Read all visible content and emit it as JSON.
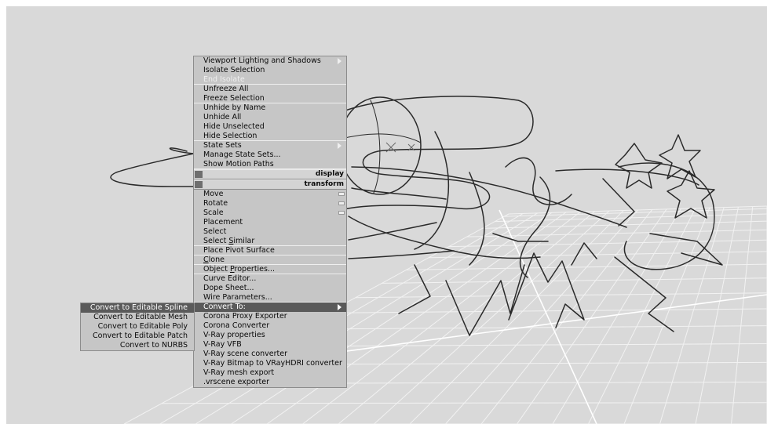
{
  "quad_menu": {
    "items_top": [
      {
        "label": "Viewport Lighting and Shadows",
        "submenu": true
      },
      {
        "label": "Isolate Selection"
      },
      {
        "label": "End Isolate",
        "disabled": true
      },
      {
        "label": "Unfreeze All"
      },
      {
        "label": "Freeze Selection"
      },
      {
        "label": "Unhide by Name"
      },
      {
        "label": "Unhide All"
      },
      {
        "label": "Hide Unselected"
      },
      {
        "label": "Hide Selection"
      },
      {
        "label": "State Sets",
        "submenu": true
      },
      {
        "label": "Manage State Sets..."
      },
      {
        "label": "Show Motion Paths"
      }
    ],
    "display_header": "display",
    "transform_header": "transform",
    "items_transform": [
      {
        "label_pre": "Move",
        "has_settings": true
      },
      {
        "label_pre": "Rotate",
        "has_settings": true
      },
      {
        "label_pre": "Scale",
        "has_settings": true
      },
      {
        "label_pre": "Placement"
      },
      {
        "label_pre": "Select"
      },
      {
        "label_pre": "Select ",
        "label_u": "S",
        "label_post": "imilar"
      },
      {
        "label_pre": "Place Pivot Surface"
      },
      {
        "label_pre": "",
        "label_u": "C",
        "label_post": "lone"
      },
      {
        "label_pre": "Object ",
        "label_u": "P",
        "label_post": "roperties..."
      },
      {
        "label_pre": "Curve Editor..."
      },
      {
        "label_pre": "Dope Sheet..."
      },
      {
        "label_pre": "Wire Parameters..."
      },
      {
        "label_pre": "Convert To:"
      },
      {
        "label_pre": "Corona Proxy Exporter"
      },
      {
        "label_pre": "Corona Converter"
      },
      {
        "label_pre": "V-Ray properties"
      },
      {
        "label_pre": "V-Ray VFB"
      },
      {
        "label_pre": "V-Ray scene converter"
      },
      {
        "label_pre": "V-Ray Bitmap to VRayHDRI converter"
      },
      {
        "label_pre": "V-Ray mesh export"
      },
      {
        "label_pre": ".vrscene exporter"
      }
    ]
  },
  "convert_submenu": {
    "items": [
      "Convert to Editable Spline",
      "Convert to Editable Mesh",
      "Convert to Editable Poly",
      "Convert to Editable Patch",
      "Convert to NURBS"
    ]
  },
  "colors": {
    "viewport_bg": "#d9d9d9",
    "menu_bg": "#c6c6c6",
    "highlight": "#5a5a5a",
    "grid_line": "#f2f2f2",
    "spline_line": "#2a2a2a"
  }
}
